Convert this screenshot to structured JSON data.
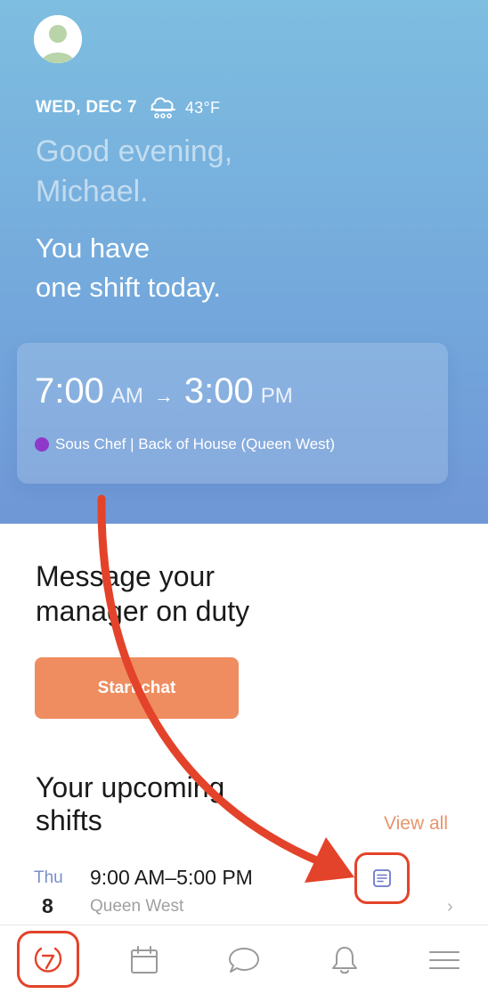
{
  "header": {
    "date": "WED, DEC 7",
    "temperature": "43°F",
    "weather_icon": "rain-cloud-icon",
    "greeting_line1": "Good evening,",
    "greeting_line2": "Michael.",
    "shift_count_line1": "You have",
    "shift_count_line2": "one shift today."
  },
  "today_shift": {
    "start_time": "7:00",
    "start_period": "AM",
    "arrow": "→",
    "end_time": "3:00",
    "end_period": "PM",
    "role": "Sous Chef | Back of House (Queen West)",
    "role_color": "#8e39c9"
  },
  "message": {
    "title_line1": "Message your",
    "title_line2": "manager on duty",
    "button_label": "Start chat"
  },
  "upcoming": {
    "title_line1": "Your upcoming",
    "title_line2": "shifts",
    "view_all": "View all",
    "shifts": [
      {
        "day": "Thu",
        "date": "8",
        "hours": "9:00 AM–5:00 PM",
        "location": "Queen West",
        "note_icon": "note-icon"
      }
    ]
  },
  "tabbar": {
    "items": [
      "home-logo-icon",
      "calendar-icon",
      "chat-bubble-icon",
      "bell-icon",
      "menu-icon"
    ]
  },
  "colors": {
    "accent": "#ef8c60",
    "annotation_red": "#e3432a",
    "view_all": "#e7956c"
  }
}
